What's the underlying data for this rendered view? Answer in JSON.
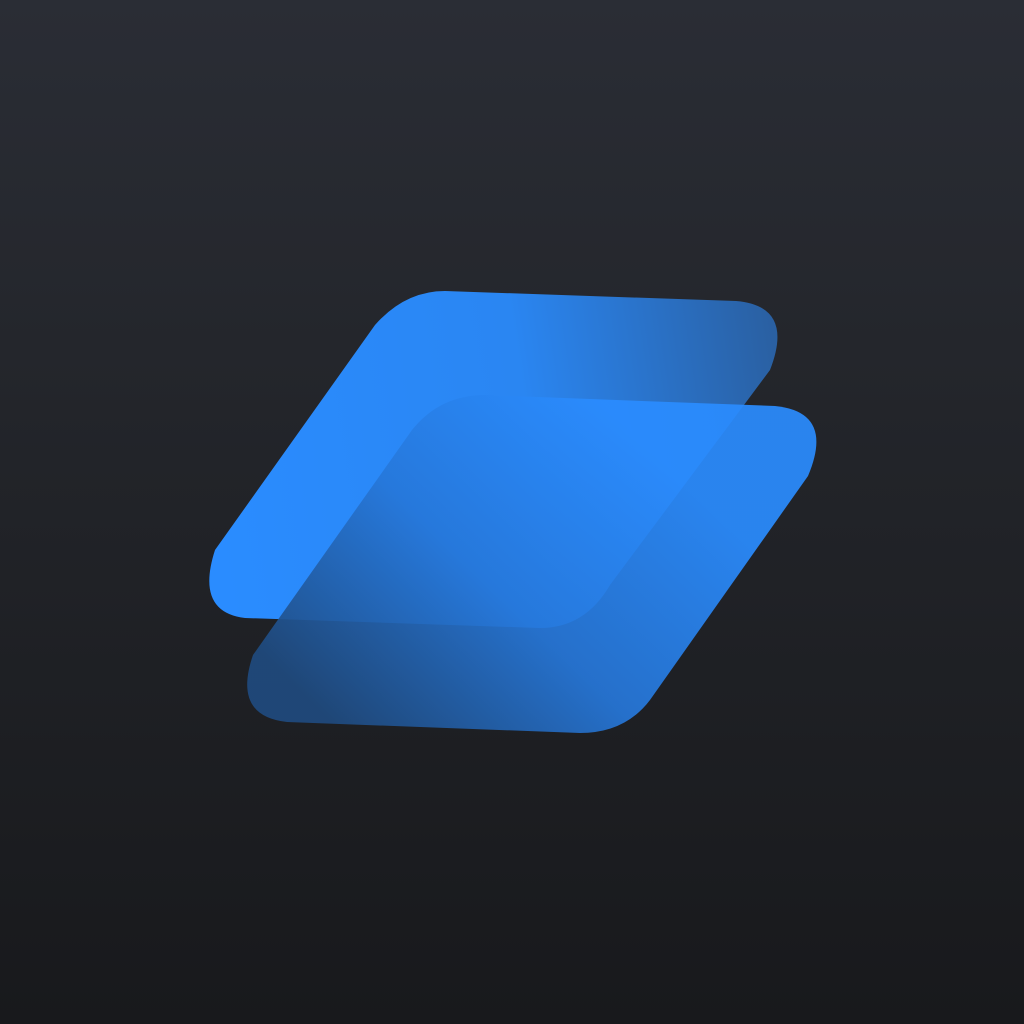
{
  "icon": {
    "name": "stacked-layers-icon",
    "description_visible_text": "",
    "colors": {
      "background_top": "#2a2d35",
      "background_bottom": "#18191c",
      "accent_blue": "#2a8cff",
      "accent_blue_shade": "#1f5fae"
    }
  }
}
